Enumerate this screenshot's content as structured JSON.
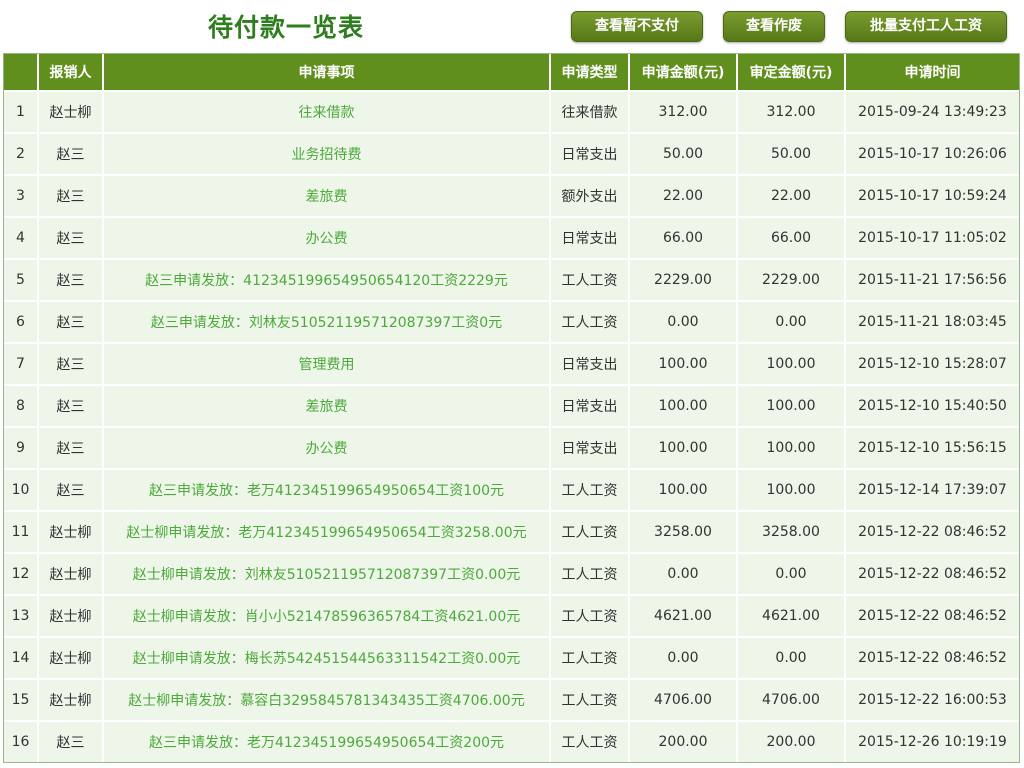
{
  "page": {
    "title": "待付款一览表"
  },
  "toolbar": {
    "view_unpaid": "查看暂不支付",
    "view_voided": "查看作废",
    "batch_pay": "批量支付工人工资"
  },
  "table": {
    "headers": [
      "",
      "报销人",
      "申请事项",
      "申请类型",
      "申请金额(元)",
      "审定金额(元)",
      "申请时间"
    ],
    "rows": [
      {
        "no": "1",
        "person": "赵士柳",
        "item": "往来借款",
        "type": "往来借款",
        "amount": "312.00",
        "approved": "312.00",
        "time": "2015-09-24 13:49:23"
      },
      {
        "no": "2",
        "person": "赵三",
        "item": "业务招待费",
        "type": "日常支出",
        "amount": "50.00",
        "approved": "50.00",
        "time": "2015-10-17 10:26:06"
      },
      {
        "no": "3",
        "person": "赵三",
        "item": "差旅费",
        "type": "额外支出",
        "amount": "22.00",
        "approved": "22.00",
        "time": "2015-10-17 10:59:24"
      },
      {
        "no": "4",
        "person": "赵三",
        "item": "办公费",
        "type": "日常支出",
        "amount": "66.00",
        "approved": "66.00",
        "time": "2015-10-17 11:05:02"
      },
      {
        "no": "5",
        "person": "赵三",
        "item": "赵三申请发放：412345199654950654120工资2229元",
        "type": "工人工资",
        "amount": "2229.00",
        "approved": "2229.00",
        "time": "2015-11-21 17:56:56"
      },
      {
        "no": "6",
        "person": "赵三",
        "item": "赵三申请发放：刘林友510521195712087397工资0元",
        "type": "工人工资",
        "amount": "0.00",
        "approved": "0.00",
        "time": "2015-11-21 18:03:45"
      },
      {
        "no": "7",
        "person": "赵三",
        "item": "管理费用",
        "type": "日常支出",
        "amount": "100.00",
        "approved": "100.00",
        "time": "2015-12-10 15:28:07"
      },
      {
        "no": "8",
        "person": "赵三",
        "item": "差旅费",
        "type": "日常支出",
        "amount": "100.00",
        "approved": "100.00",
        "time": "2015-12-10 15:40:50"
      },
      {
        "no": "9",
        "person": "赵三",
        "item": "办公费",
        "type": "日常支出",
        "amount": "100.00",
        "approved": "100.00",
        "time": "2015-12-10 15:56:15"
      },
      {
        "no": "10",
        "person": "赵三",
        "item": "赵三申请发放：老万412345199654950654工资100元",
        "type": "工人工资",
        "amount": "100.00",
        "approved": "100.00",
        "time": "2015-12-14 17:39:07"
      },
      {
        "no": "11",
        "person": "赵士柳",
        "item": "赵士柳申请发放：老万412345199654950654工资3258.00元",
        "type": "工人工资",
        "amount": "3258.00",
        "approved": "3258.00",
        "time": "2015-12-22 08:46:52"
      },
      {
        "no": "12",
        "person": "赵士柳",
        "item": "赵士柳申请发放：刘林友510521195712087397工资0.00元",
        "type": "工人工资",
        "amount": "0.00",
        "approved": "0.00",
        "time": "2015-12-22 08:46:52"
      },
      {
        "no": "13",
        "person": "赵士柳",
        "item": "赵士柳申请发放：肖小小521478596365784工资4621.00元",
        "type": "工人工资",
        "amount": "4621.00",
        "approved": "4621.00",
        "time": "2015-12-22 08:46:52"
      },
      {
        "no": "14",
        "person": "赵士柳",
        "item": "赵士柳申请发放：梅长苏542451544563311542工资0.00元",
        "type": "工人工资",
        "amount": "0.00",
        "approved": "0.00",
        "time": "2015-12-22 08:46:52"
      },
      {
        "no": "15",
        "person": "赵士柳",
        "item": "赵士柳申请发放：慕容白3295845781343435工资4706.00元",
        "type": "工人工资",
        "amount": "4706.00",
        "approved": "4706.00",
        "time": "2015-12-22 16:00:53"
      },
      {
        "no": "16",
        "person": "赵三",
        "item": "赵三申请发放：老万412345199654950654工资200元",
        "type": "工人工资",
        "amount": "200.00",
        "approved": "200.00",
        "time": "2015-12-26 10:19:19"
      }
    ]
  }
}
